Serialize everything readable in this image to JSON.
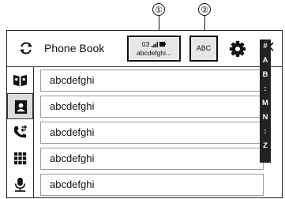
{
  "callouts": [
    "①",
    "②"
  ],
  "header": {
    "title": "Phone Book",
    "device_status": "03",
    "device_name": "abcdefghi...",
    "search_mode_label": "ABC"
  },
  "contacts": [
    "abcdefghi",
    "abcdefghi",
    "abcdefghi",
    "abcdefghi",
    "abcdefghi"
  ],
  "index_letters": [
    "#",
    "A",
    "B",
    ":",
    "M",
    "N",
    ":",
    "Z"
  ],
  "sidebar": {
    "items": [
      "contacts-book-icon",
      "phone-book-icon",
      "call-history-icon",
      "keypad-icon",
      "voice-recognition-icon"
    ]
  }
}
